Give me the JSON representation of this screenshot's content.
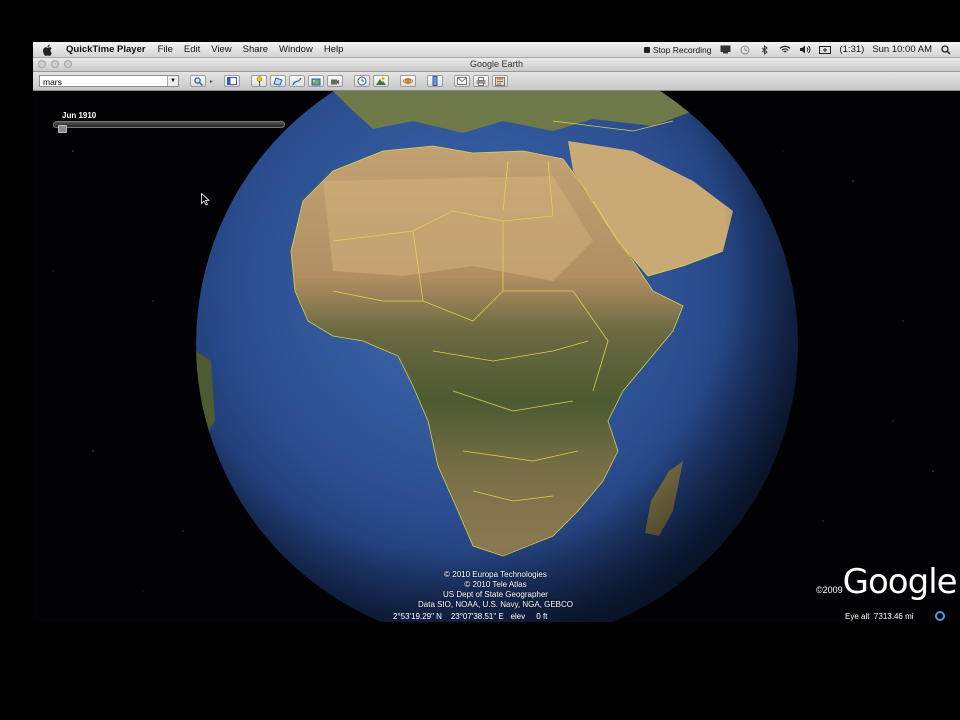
{
  "menubar": {
    "app_name": "QuickTime Player",
    "menus": [
      "File",
      "Edit",
      "View",
      "Share",
      "Window",
      "Help"
    ],
    "stop_recording": "Stop Recording",
    "battery": "(1:31)",
    "clock": "Sun 10:00 AM"
  },
  "window": {
    "title": "Google Earth"
  },
  "toolbar": {
    "search_value": "mars",
    "buttons": [
      "search-button",
      "sidebar-toggle",
      "add-placemark",
      "add-polygon",
      "add-path",
      "add-image-overlay",
      "record-tour",
      "historical-imagery",
      "sunlight",
      "switch-planet",
      "ruler",
      "email",
      "print",
      "view-in-maps"
    ]
  },
  "viewport": {
    "time_slider": {
      "date": "Jun 1910",
      "position_fraction": 0.0
    },
    "credits": [
      "© 2010 Europa Technologies",
      "© 2010 Tele Atlas",
      "US Dept of State Geographer",
      "Data SIO, NOAA, U.S. Navy, NGA, GEBCO"
    ],
    "logo_year": "©2009",
    "logo_word": "Google",
    "status": {
      "latitude": "2°53'19.29\" N",
      "longitude": "23°07'38.51\" E",
      "elev_label": "elev",
      "elev_value": "0 ft",
      "eye_alt_label": "Eye alt",
      "eye_alt_value": "7313.46 mi"
    }
  },
  "colors": {
    "ocean": "#2a4d8f",
    "land_desert": "#b89a6a",
    "land_green": "#4e5a32",
    "borders": "#e8d84a",
    "space": "#020204",
    "nav_ring": "#4a9adf"
  }
}
